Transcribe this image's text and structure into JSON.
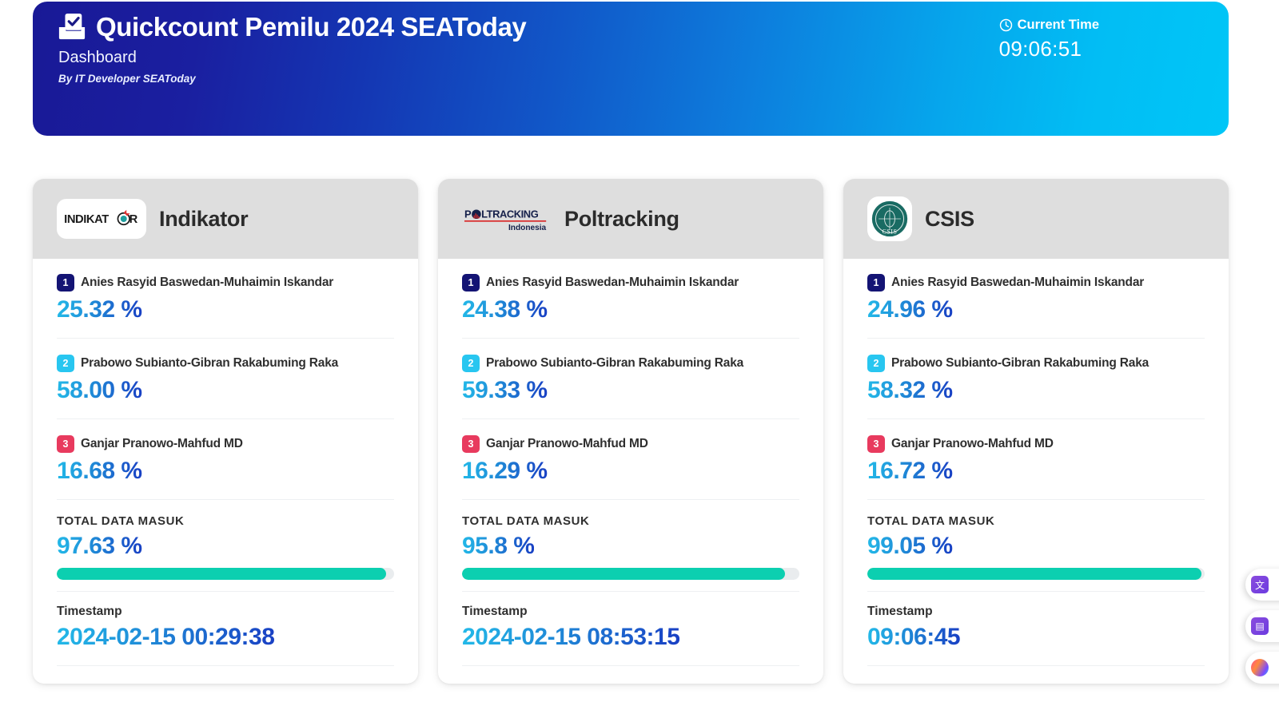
{
  "header": {
    "icon": "ballot-box-icon",
    "title": "Quickcount Pemilu 2024 SEAToday",
    "subtitle": "Dashboard",
    "byline": "By IT Developer SEAToday",
    "clock_icon": "clock-icon",
    "current_time_label": "Current Time",
    "current_time_value": "09:06:51",
    "gradient_from": "#191996",
    "gradient_to": "#00c6f7"
  },
  "labels": {
    "total_label": "TOTAL DATA MASUK",
    "timestamp_label": "Timestamp"
  },
  "badge_colors": [
    "#141474",
    "#28c6f0",
    "#e83a5e"
  ],
  "progress_color": "#0ccfb0",
  "cards": [
    {
      "logo_name": "indikator-logo",
      "logo_text": "INDIKATOR",
      "title": "Indikator",
      "candidates": [
        {
          "number": "1",
          "name": "Anies Rasyid Baswedan-Muhaimin Iskandar",
          "value": "25.32 %"
        },
        {
          "number": "2",
          "name": "Prabowo Subianto-Gibran Rakabuming Raka",
          "value": "58.00 %"
        },
        {
          "number": "3",
          "name": "Ganjar Pranowo-Mahfud MD",
          "value": "16.68 %"
        }
      ],
      "total_value": "97.63 %",
      "total_percent": 97.63,
      "timestamp_value": "2024-02-15 00:29:38"
    },
    {
      "logo_name": "poltracking-logo",
      "logo_text": "POLTRACKING",
      "logo_subtext": "Indonesia",
      "title": "Poltracking",
      "candidates": [
        {
          "number": "1",
          "name": "Anies Rasyid Baswedan-Muhaimin Iskandar",
          "value": "24.38 %"
        },
        {
          "number": "2",
          "name": "Prabowo Subianto-Gibran Rakabuming Raka",
          "value": "59.33 %"
        },
        {
          "number": "3",
          "name": "Ganjar Pranowo-Mahfud MD",
          "value": "16.29 %"
        }
      ],
      "total_value": "95.8 %",
      "total_percent": 95.8,
      "timestamp_value": "2024-02-15 08:53:15"
    },
    {
      "logo_name": "csis-logo",
      "logo_text": "CSIS",
      "title": "CSIS",
      "candidates": [
        {
          "number": "1",
          "name": "Anies Rasyid Baswedan-Muhaimin Iskandar",
          "value": "24.96 %"
        },
        {
          "number": "2",
          "name": "Prabowo Subianto-Gibran Rakabuming Raka",
          "value": "58.32 %"
        },
        {
          "number": "3",
          "name": "Ganjar Pranowo-Mahfud MD",
          "value": "16.72 %"
        }
      ],
      "total_value": "99.05 %",
      "total_percent": 99.05,
      "timestamp_value": "09:06:45"
    }
  ],
  "extensions": [
    {
      "name": "translate-widget",
      "icon": "translate-icon",
      "glyph": "文"
    },
    {
      "name": "dictionary-widget",
      "icon": "book-icon",
      "glyph": "▤"
    },
    {
      "name": "ai-assistant-widget",
      "icon": "ai-brain-icon",
      "glyph": ""
    }
  ]
}
